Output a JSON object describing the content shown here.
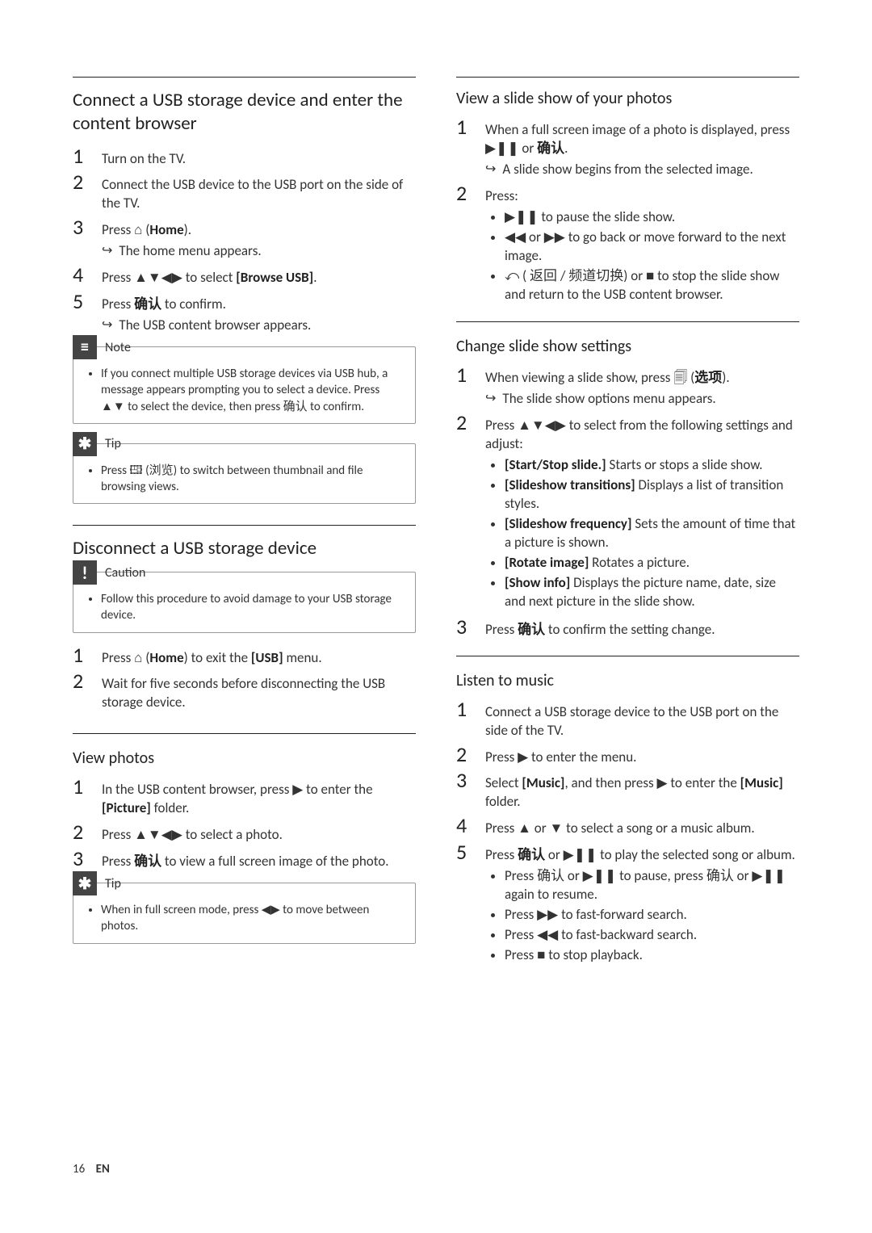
{
  "left": {
    "sec1": {
      "title": "Connect a USB storage device and enter the content browser",
      "steps": [
        {
          "text": "Turn on the TV."
        },
        {
          "text_pre": "Connect the USB device to the USB port on the side of the TV."
        },
        {
          "text_pre": "Press ",
          "icon": "⌂",
          "text_post": " (",
          "bold": "Home",
          "text_after": ").",
          "result": "The home menu appears."
        },
        {
          "text_pre": "Press ",
          "icon": "▲▼◀▶",
          "text_post": " to select ",
          "bold": "[Browse USB]",
          "text_after": "."
        },
        {
          "text_pre": "Press ",
          "cjk": "确认",
          "text_post": " to confirm.",
          "result": "The USB content browser appears."
        }
      ],
      "note_label": "Note",
      "note_body": "If you connect multiple USB storage devices via USB hub, a message appears prompting you to select a device. Press ▲▼ to select the device, then press 确认 to confirm.",
      "tip_label": "Tip",
      "tip_body": "Press 🖽 (浏览) to switch between thumbnail and file browsing views."
    },
    "sec2": {
      "title": "Disconnect a USB storage device",
      "caution_label": "Caution",
      "caution_body": "Follow this procedure to avoid damage to your USB storage device.",
      "steps": [
        {
          "text_pre": "Press ",
          "icon": "⌂",
          "text_post": " (",
          "bold": "Home",
          "text_mid": ") to exit the ",
          "bold2": "[USB]",
          "text_after": " menu."
        },
        {
          "text": "Wait for five seconds before disconnecting the USB storage device."
        }
      ]
    },
    "sec3": {
      "title": "View photos",
      "steps": [
        {
          "text_pre": "In the USB content browser, press ",
          "icon": "▶",
          "text_post": " to enter the ",
          "bold": "[Picture]",
          "text_after": " folder."
        },
        {
          "text_pre": "Press ",
          "icon": "▲▼◀▶",
          "text_post": " to select a photo."
        },
        {
          "text_pre": "Press ",
          "cjk": "确认",
          "text_post": " to view a full screen image of the photo."
        }
      ],
      "tip_label": "Tip",
      "tip_body": "When in full screen mode, press ◀▶ to move between photos."
    }
  },
  "right": {
    "sec4": {
      "title": "View a slide show of your photos",
      "steps": [
        {
          "text_pre": "When a full screen image of a photo is displayed, press ",
          "icon": "▶❚❚",
          "text_post": " or ",
          "cjk": "确认",
          "text_after": ".",
          "result": "A slide show begins from the selected image."
        },
        {
          "text": "Press:",
          "bullets": [
            "▶❚❚ to pause the slide show.",
            "◀◀ or ▶▶ to go back or move forward to the next image.",
            "⤺ ( 返回 / 频道切换) or ■ to stop the slide show and return to the USB content browser."
          ]
        }
      ]
    },
    "sec5": {
      "title": "Change slide show settings",
      "steps": [
        {
          "text_pre": "When viewing a slide show, press ",
          "icon": "🗐",
          "text_post": " (",
          "cjk": "选项",
          "text_after": ").",
          "result": "The slide show options menu appears."
        },
        {
          "text_pre": "Press ",
          "icon": "▲▼◀▶",
          "text_post": " to select from the following settings and adjust:",
          "opt_bullets": [
            {
              "b": "[Start/Stop slide.]",
              "t": " Starts or stops a slide show."
            },
            {
              "b": "[Slideshow transitions]",
              "t": " Displays a list of transition styles."
            },
            {
              "b": "[Slideshow frequency]",
              "t": " Sets the amount of time that a picture is shown."
            },
            {
              "b": "[Rotate image]",
              "t": " Rotates a picture."
            },
            {
              "b": "[Show info]",
              "t": " Displays the picture name, date, size and next picture in the slide show."
            }
          ]
        },
        {
          "text_pre": "Press ",
          "cjk": "确认",
          "text_post": " to confirm the setting change."
        }
      ]
    },
    "sec6": {
      "title": "Listen to music",
      "steps": [
        {
          "text": "Connect a USB storage device to the USB port on the side of the TV."
        },
        {
          "text_pre": "Press ",
          "icon": "▶",
          "text_post": " to enter the menu."
        },
        {
          "text_pre": "Select ",
          "bold": "[Music]",
          "text_mid": ", and then press ",
          "icon": "▶",
          "text_post": " to enter the ",
          "bold2": "[Music]",
          "text_after": " folder."
        },
        {
          "text_pre": "Press ",
          "icon": "▲",
          "text_mid": " or ",
          "icon2": "▼",
          "text_post": " to select a song or a music album."
        },
        {
          "text_pre": "Press ",
          "cjk": "确认",
          "text_mid": " or ",
          "icon": "▶❚❚",
          "text_post": " to play the selected song or album.",
          "bullets": [
            "Press 确认 or ▶❚❚ to pause, press 确认 or ▶❚❚ again to resume.",
            "Press ▶▶ to fast-forward search.",
            "Press ◀◀ to fast-backward search.",
            "Press ■ to stop playback."
          ]
        }
      ]
    }
  },
  "footer": {
    "page": "16",
    "lang": "EN"
  }
}
